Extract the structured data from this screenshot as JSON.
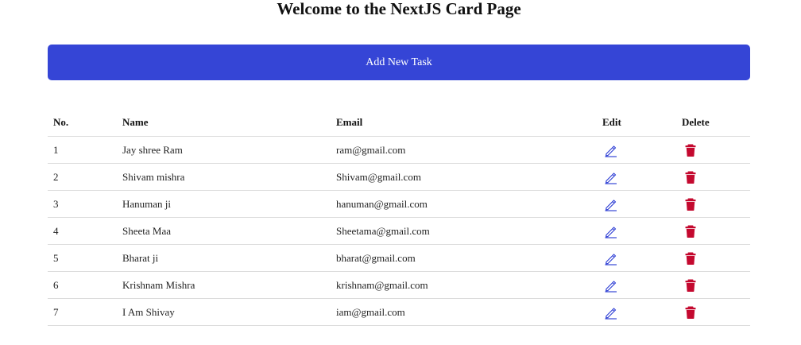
{
  "page": {
    "title": "Welcome to the NextJS Card Page"
  },
  "toolbar": {
    "add_label": "Add New Task"
  },
  "colors": {
    "button_bg": "#3545d6",
    "edit_icon": "#3545d6",
    "delete_icon": "#c4092f"
  },
  "table": {
    "headers": {
      "no": "No.",
      "name": "Name",
      "email": "Email",
      "edit": "Edit",
      "delete": "Delete"
    },
    "edit_icon_name": "pencil-icon",
    "delete_icon_name": "trash-icon",
    "rows": [
      {
        "no": "1",
        "name": "Jay shree Ram",
        "email": "ram@gmail.com"
      },
      {
        "no": "2",
        "name": "Shivam mishra",
        "email": "Shivam@gmail.com"
      },
      {
        "no": "3",
        "name": "Hanuman ji",
        "email": "hanuman@gmail.com"
      },
      {
        "no": "4",
        "name": "Sheeta Maa",
        "email": "Sheetama@gmail.com"
      },
      {
        "no": "5",
        "name": "Bharat ji",
        "email": "bharat@gmail.com"
      },
      {
        "no": "6",
        "name": "Krishnam Mishra",
        "email": "krishnam@gmail.com"
      },
      {
        "no": "7",
        "name": "I Am Shivay",
        "email": "iam@gmail.com"
      }
    ]
  }
}
